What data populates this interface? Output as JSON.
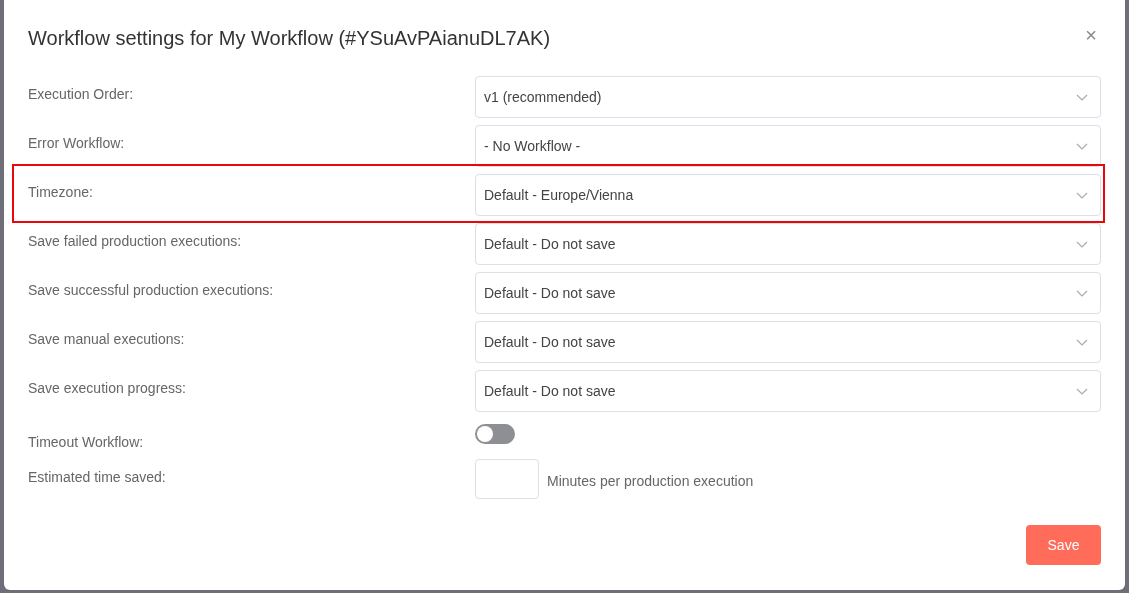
{
  "dialog": {
    "title": "Workflow settings for My Workflow (#YSuAvPAianuDL7AK)",
    "close": "×"
  },
  "settings": [
    {
      "kind": "select",
      "label": "Execution Order:",
      "value": "v1 (recommended)",
      "highlighted": false
    },
    {
      "kind": "select",
      "label": "Error Workflow:",
      "value": "- No Workflow -",
      "highlighted": false
    },
    {
      "kind": "select",
      "label": "Timezone:",
      "value": "Default - Europe/Vienna",
      "highlighted": true
    },
    {
      "kind": "select",
      "label": "Save failed production executions:",
      "value": "Default - Do not save",
      "highlighted": false
    },
    {
      "kind": "select",
      "label": "Save successful production executions:",
      "value": "Default - Do not save",
      "highlighted": false
    },
    {
      "kind": "select",
      "label": "Save manual executions:",
      "value": "Default - Do not save",
      "highlighted": false
    },
    {
      "kind": "select",
      "label": "Save execution progress:",
      "value": "Default - Do not save",
      "highlighted": false
    },
    {
      "kind": "toggle",
      "label": "Timeout Workflow:",
      "on": false
    },
    {
      "kind": "number",
      "label": "Estimated time saved:",
      "suffix": "Minutes per production execution"
    }
  ],
  "buttons": {
    "save": "Save"
  }
}
